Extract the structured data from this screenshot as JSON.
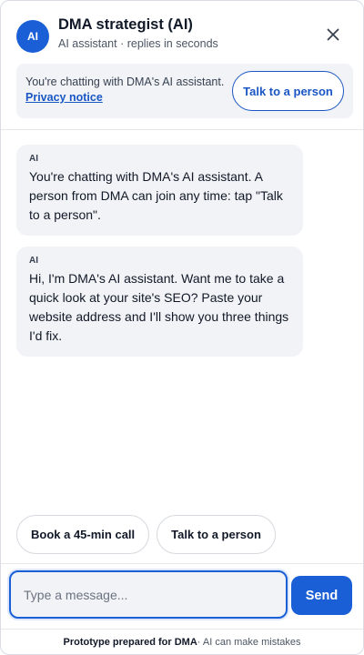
{
  "header": {
    "avatar_text": "AI",
    "title": "DMA strategist (AI)",
    "subtitle": "AI assistant · replies in seconds",
    "close_icon": "close-icon"
  },
  "notice": {
    "text": "You're chatting with DMA's AI assistant.",
    "link": "Privacy notice",
    "talk_button": "Talk to a person"
  },
  "messages": [
    {
      "sender": "AI",
      "text": "You're chatting with DMA's AI assistant. A person from DMA can join any time: tap \"Talk to a person\"."
    },
    {
      "sender": "AI",
      "text": "Hi, I'm DMA's AI assistant. Want me to take a quick look at your site's SEO? Paste your website address and I'll show you three things I'd fix."
    }
  ],
  "quick_replies": [
    {
      "label": "Book a 45-min call"
    },
    {
      "label": "Talk to a person"
    }
  ],
  "composer": {
    "placeholder": "Type a message...",
    "value": "",
    "send_label": "Send"
  },
  "footer": {
    "strong": "Prototype prepared for DMA",
    "rest": " · AI can make mistakes"
  },
  "colors": {
    "accent": "#1a5fd6",
    "link": "#1a56c4",
    "bubble_bg": "#f1f3f6"
  }
}
